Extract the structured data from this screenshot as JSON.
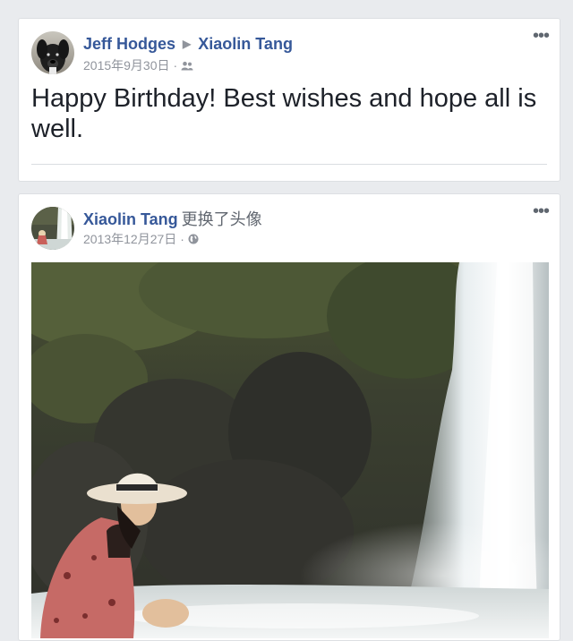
{
  "posts": [
    {
      "author": "Jeff Hodges",
      "target": "Xiaolin Tang",
      "timestamp": "2015年9月30日",
      "privacy_icon": "friends-icon",
      "text": "Happy Birthday! Best wishes and hope all is well."
    },
    {
      "author": "Xiaolin Tang",
      "action": "更换了头像",
      "timestamp": "2013年12月27日",
      "privacy_icon": "globe-icon"
    }
  ],
  "separator": "·",
  "more_glyph": "•••",
  "arrow_glyph": "▶"
}
